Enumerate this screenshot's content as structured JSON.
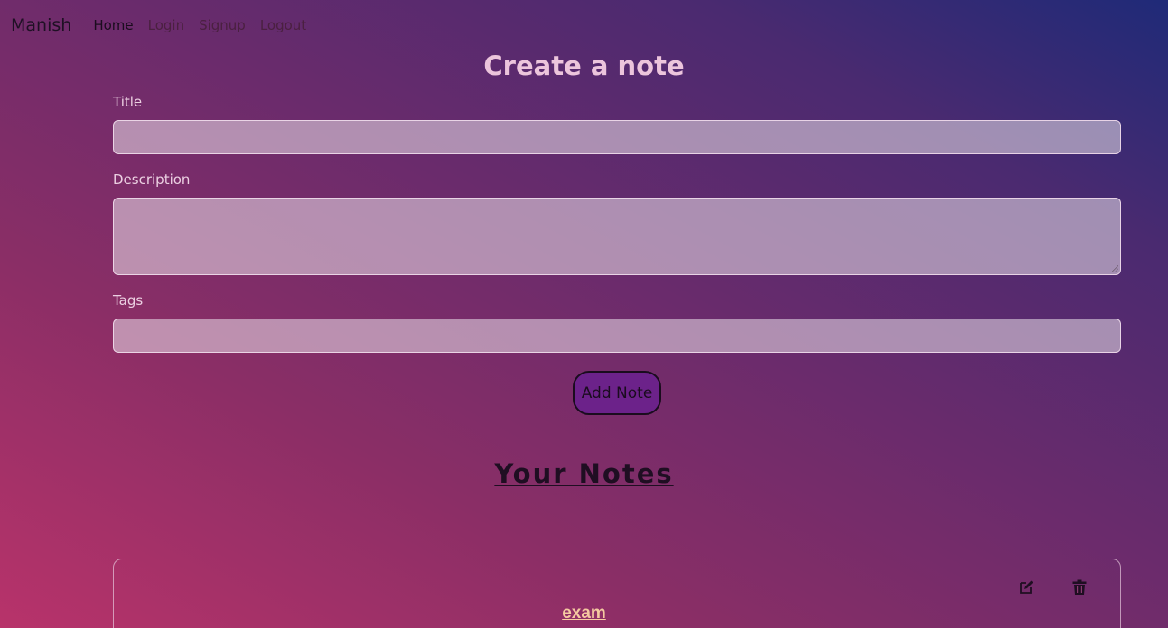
{
  "navbar": {
    "brand": "Manish",
    "links": [
      {
        "label": "Home"
      },
      {
        "label": "Login"
      },
      {
        "label": "Signup"
      },
      {
        "label": "Logout"
      }
    ]
  },
  "form": {
    "heading": "Create a note",
    "title_label": "Title",
    "title_value": "",
    "description_label": "Description",
    "description_value": "",
    "tags_label": "Tags",
    "tags_value": "",
    "submit_label": "Add Note"
  },
  "notes": {
    "heading": "Your Notes",
    "items": [
      {
        "title": "exam",
        "edit_icon": "edit-icon",
        "delete_icon": "trash-icon"
      }
    ]
  },
  "colors": {
    "button_bg": "#6c228a",
    "note_title": "#f5c9a0"
  }
}
